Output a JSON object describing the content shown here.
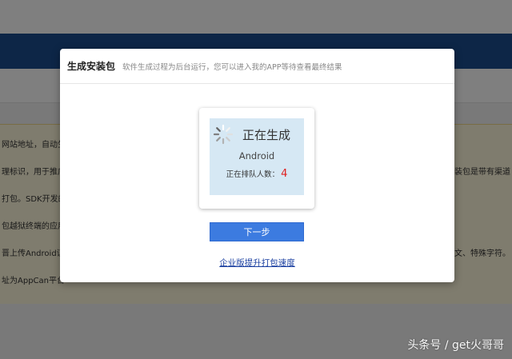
{
  "background": {
    "notice_lines_left": [
      "网站地址，自动生",
      "理标识，用于推广",
      "打包。SDK开发的",
      "包越狱终端的应用",
      "晋上传Android证",
      "址为AppCan平台"
    ],
    "notice_lines_right": [
      "卖装包是带有渠道",
      "文、特殊字符。"
    ]
  },
  "modal": {
    "title": "生成安装包",
    "subtitle": "软件生成过程为后台运行，您可以进入我的APP等待查看最终结果",
    "status_text": "正在生成",
    "platform": "Android",
    "queue_label": "正在排队人数：",
    "queue_count": "4",
    "next_button": "下一步",
    "enterprise_link": "企业版提升打包速度"
  },
  "watermark": "头条号 / get火哥哥",
  "colors": {
    "navbar": "#1b4d8f",
    "primary_button": "#3c7be0",
    "link": "#1a3fa0",
    "queue_count": "#e02020",
    "card_inner": "#d6e8f4"
  }
}
